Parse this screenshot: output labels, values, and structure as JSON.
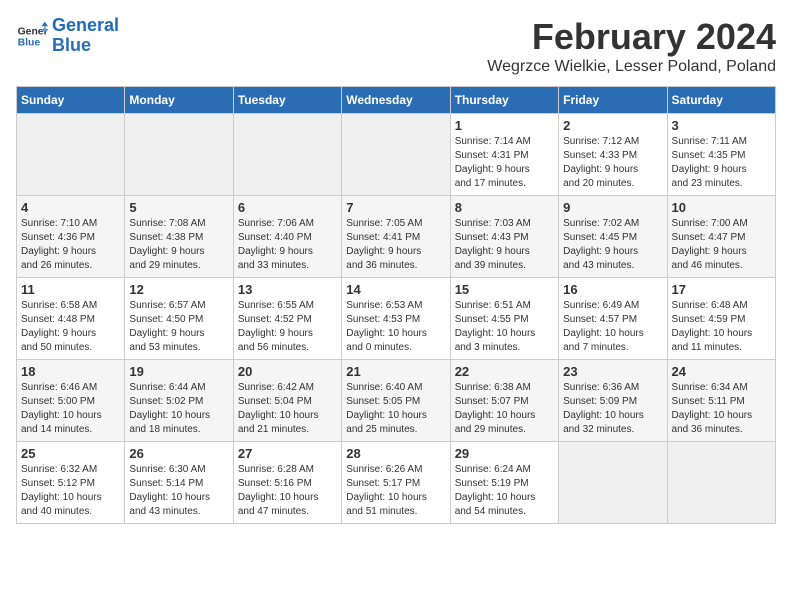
{
  "header": {
    "logo_line1": "General",
    "logo_line2": "Blue",
    "month_title": "February 2024",
    "location": "Wegrzce Wielkie, Lesser Poland, Poland"
  },
  "weekdays": [
    "Sunday",
    "Monday",
    "Tuesday",
    "Wednesday",
    "Thursday",
    "Friday",
    "Saturday"
  ],
  "weeks": [
    [
      {
        "day": "",
        "info": ""
      },
      {
        "day": "",
        "info": ""
      },
      {
        "day": "",
        "info": ""
      },
      {
        "day": "",
        "info": ""
      },
      {
        "day": "1",
        "info": "Sunrise: 7:14 AM\nSunset: 4:31 PM\nDaylight: 9 hours\nand 17 minutes."
      },
      {
        "day": "2",
        "info": "Sunrise: 7:12 AM\nSunset: 4:33 PM\nDaylight: 9 hours\nand 20 minutes."
      },
      {
        "day": "3",
        "info": "Sunrise: 7:11 AM\nSunset: 4:35 PM\nDaylight: 9 hours\nand 23 minutes."
      }
    ],
    [
      {
        "day": "4",
        "info": "Sunrise: 7:10 AM\nSunset: 4:36 PM\nDaylight: 9 hours\nand 26 minutes."
      },
      {
        "day": "5",
        "info": "Sunrise: 7:08 AM\nSunset: 4:38 PM\nDaylight: 9 hours\nand 29 minutes."
      },
      {
        "day": "6",
        "info": "Sunrise: 7:06 AM\nSunset: 4:40 PM\nDaylight: 9 hours\nand 33 minutes."
      },
      {
        "day": "7",
        "info": "Sunrise: 7:05 AM\nSunset: 4:41 PM\nDaylight: 9 hours\nand 36 minutes."
      },
      {
        "day": "8",
        "info": "Sunrise: 7:03 AM\nSunset: 4:43 PM\nDaylight: 9 hours\nand 39 minutes."
      },
      {
        "day": "9",
        "info": "Sunrise: 7:02 AM\nSunset: 4:45 PM\nDaylight: 9 hours\nand 43 minutes."
      },
      {
        "day": "10",
        "info": "Sunrise: 7:00 AM\nSunset: 4:47 PM\nDaylight: 9 hours\nand 46 minutes."
      }
    ],
    [
      {
        "day": "11",
        "info": "Sunrise: 6:58 AM\nSunset: 4:48 PM\nDaylight: 9 hours\nand 50 minutes."
      },
      {
        "day": "12",
        "info": "Sunrise: 6:57 AM\nSunset: 4:50 PM\nDaylight: 9 hours\nand 53 minutes."
      },
      {
        "day": "13",
        "info": "Sunrise: 6:55 AM\nSunset: 4:52 PM\nDaylight: 9 hours\nand 56 minutes."
      },
      {
        "day": "14",
        "info": "Sunrise: 6:53 AM\nSunset: 4:53 PM\nDaylight: 10 hours\nand 0 minutes."
      },
      {
        "day": "15",
        "info": "Sunrise: 6:51 AM\nSunset: 4:55 PM\nDaylight: 10 hours\nand 3 minutes."
      },
      {
        "day": "16",
        "info": "Sunrise: 6:49 AM\nSunset: 4:57 PM\nDaylight: 10 hours\nand 7 minutes."
      },
      {
        "day": "17",
        "info": "Sunrise: 6:48 AM\nSunset: 4:59 PM\nDaylight: 10 hours\nand 11 minutes."
      }
    ],
    [
      {
        "day": "18",
        "info": "Sunrise: 6:46 AM\nSunset: 5:00 PM\nDaylight: 10 hours\nand 14 minutes."
      },
      {
        "day": "19",
        "info": "Sunrise: 6:44 AM\nSunset: 5:02 PM\nDaylight: 10 hours\nand 18 minutes."
      },
      {
        "day": "20",
        "info": "Sunrise: 6:42 AM\nSunset: 5:04 PM\nDaylight: 10 hours\nand 21 minutes."
      },
      {
        "day": "21",
        "info": "Sunrise: 6:40 AM\nSunset: 5:05 PM\nDaylight: 10 hours\nand 25 minutes."
      },
      {
        "day": "22",
        "info": "Sunrise: 6:38 AM\nSunset: 5:07 PM\nDaylight: 10 hours\nand 29 minutes."
      },
      {
        "day": "23",
        "info": "Sunrise: 6:36 AM\nSunset: 5:09 PM\nDaylight: 10 hours\nand 32 minutes."
      },
      {
        "day": "24",
        "info": "Sunrise: 6:34 AM\nSunset: 5:11 PM\nDaylight: 10 hours\nand 36 minutes."
      }
    ],
    [
      {
        "day": "25",
        "info": "Sunrise: 6:32 AM\nSunset: 5:12 PM\nDaylight: 10 hours\nand 40 minutes."
      },
      {
        "day": "26",
        "info": "Sunrise: 6:30 AM\nSunset: 5:14 PM\nDaylight: 10 hours\nand 43 minutes."
      },
      {
        "day": "27",
        "info": "Sunrise: 6:28 AM\nSunset: 5:16 PM\nDaylight: 10 hours\nand 47 minutes."
      },
      {
        "day": "28",
        "info": "Sunrise: 6:26 AM\nSunset: 5:17 PM\nDaylight: 10 hours\nand 51 minutes."
      },
      {
        "day": "29",
        "info": "Sunrise: 6:24 AM\nSunset: 5:19 PM\nDaylight: 10 hours\nand 54 minutes."
      },
      {
        "day": "",
        "info": ""
      },
      {
        "day": "",
        "info": ""
      }
    ]
  ]
}
